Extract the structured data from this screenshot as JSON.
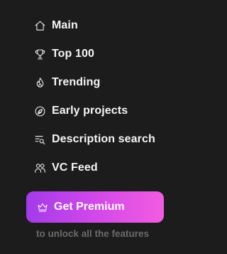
{
  "nav": {
    "items": [
      {
        "label": "Main",
        "icon": "home-icon"
      },
      {
        "label": "Top 100",
        "icon": "trophy-icon"
      },
      {
        "label": "Trending",
        "icon": "flame-icon"
      },
      {
        "label": "Early projects",
        "icon": "seedling-circle-icon"
      },
      {
        "label": "Description search",
        "icon": "text-search-icon"
      },
      {
        "label": "VC Feed",
        "icon": "users-icon"
      }
    ]
  },
  "premium": {
    "button_label": "Get Premium",
    "icon": "crown-icon",
    "subtext": "to unlock all the features",
    "gradient_start": "#a23bea",
    "gradient_end": "#f25ce0"
  },
  "colors": {
    "background": "#1c1c1c",
    "text": "#f5f5f5",
    "subtext": "#6b6b6b"
  }
}
